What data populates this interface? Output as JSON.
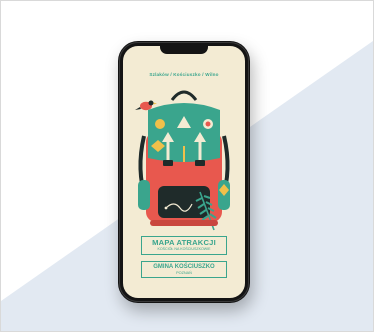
{
  "header": {
    "top_text": "Szlaków / Kościuszko / Wilno"
  },
  "title_card": {
    "title": "MAPA ATRAKCJI",
    "subtitle": "KOŚCIÓŁ NA KOŚCIUSZKOWIE"
  },
  "bottom_card": {
    "name": "GMINA KOŚCIUSZKO",
    "city": "POZNAŃ"
  },
  "colors": {
    "background": "#f4f5f8",
    "diagonal_band": "#e2e9f2",
    "phone_body": "#141414",
    "screen_bg": "#f3ebd3",
    "accent_teal": "#3aa58d",
    "accent_red": "#e8584e",
    "accent_dark": "#1f2b2a",
    "accent_yellow": "#f0c04a"
  },
  "icons": {
    "bird": "bird-icon",
    "backpack": "backpack-illustration",
    "leaf": "leaf-icon",
    "arrow": "arrow-up-icon"
  }
}
